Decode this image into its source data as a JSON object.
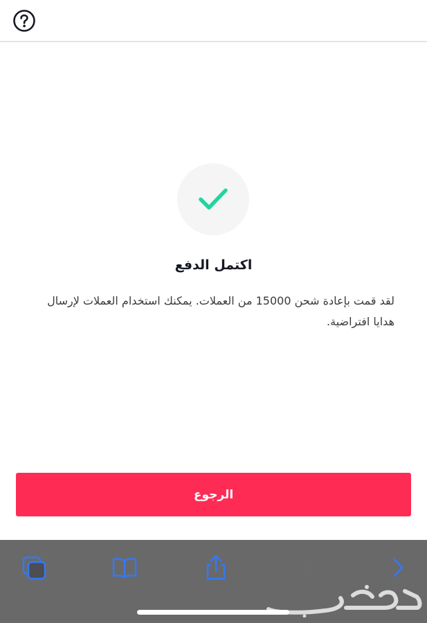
{
  "header": {
    "help_icon": "question-circle-icon"
  },
  "status": {
    "icon": "checkmark-icon",
    "accent_color": "#20d5a0",
    "title": "اكتمل الدفع",
    "message": "لقد قمت بإعادة شحن 15000 من العملات. يمكنك استخدام العملات لإرسال هدايا افتراضية."
  },
  "actions": {
    "back_label": "الرجوع",
    "button_color": "#fe2c55"
  },
  "browser_toolbar": {
    "icons": [
      "tabs-icon",
      "bookmarks-icon",
      "share-icon",
      "back-arrow-icon",
      "forward-arrow-icon"
    ],
    "accent_color": "#3478f6"
  },
  "watermark": {
    "text": "حراج"
  }
}
